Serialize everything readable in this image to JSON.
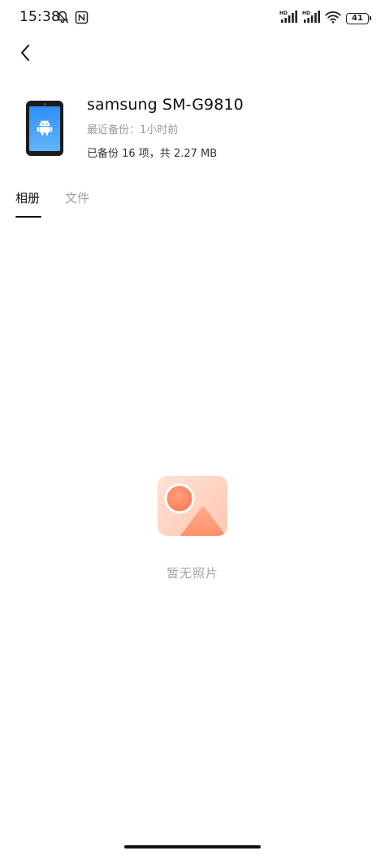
{
  "status_bar": {
    "time": "15:38",
    "battery_level": "41",
    "left_icons": [
      "alarm-off-icon",
      "nfc-icon"
    ],
    "right_icons": [
      "hd-signal-icon",
      "hd-signal-icon",
      "wifi-icon",
      "battery-icon"
    ]
  },
  "nav": {
    "back_icon": "chevron-left-icon"
  },
  "device": {
    "name": "samsung SM-G9810",
    "last_backup": "最近备份：1小时前",
    "backup_stats": "已备份 16 项，共 2.27 MB",
    "icon": "android-phone-icon"
  },
  "tabs": [
    {
      "label": "相册",
      "active": true
    },
    {
      "label": "文件",
      "active": false
    }
  ],
  "empty_state": {
    "icon": "photo-placeholder-icon",
    "text": "暂无照片",
    "colors": {
      "card_light": "#ffe0d3",
      "card_dark": "#ffb89f",
      "accent": "#ff7a4e"
    }
  }
}
